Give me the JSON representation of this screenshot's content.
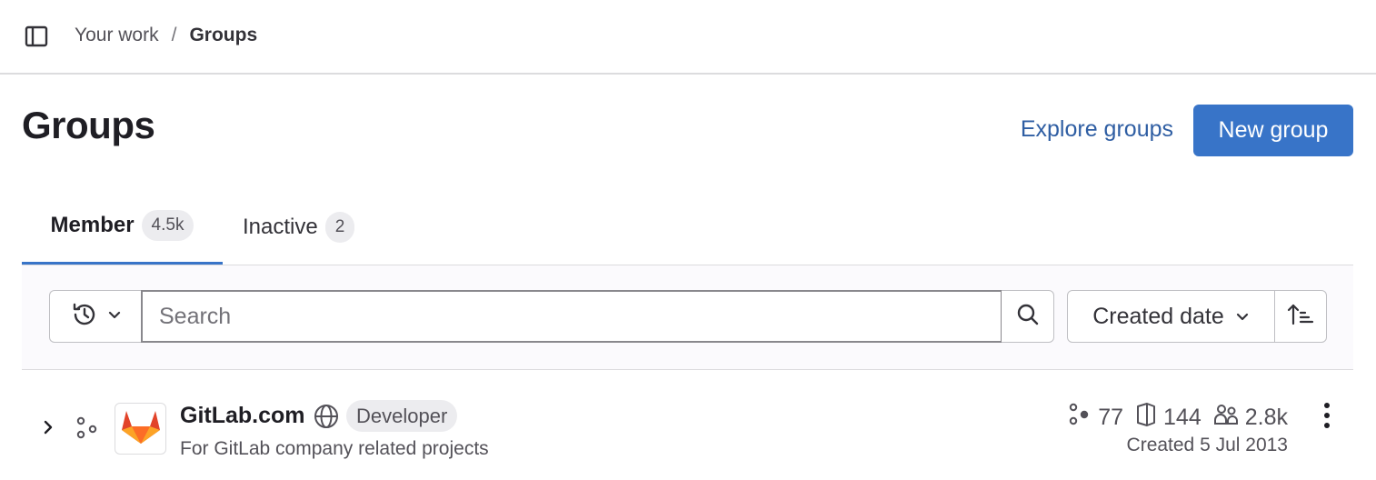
{
  "breadcrumb": {
    "parent": "Your work",
    "separator": "/",
    "current": "Groups"
  },
  "page": {
    "title": "Groups",
    "explore_link": "Explore groups",
    "new_group_button": "New group"
  },
  "tabs": [
    {
      "label": "Member",
      "count": "4.5k",
      "active": true
    },
    {
      "label": "Inactive",
      "count": "2",
      "active": false
    }
  ],
  "filters": {
    "search_placeholder": "Search",
    "sort_label": "Created date"
  },
  "groups": [
    {
      "name": "GitLab.com",
      "visibility_icon": "globe-icon",
      "role": "Developer",
      "description": "For GitLab company related projects",
      "subgroups": "77",
      "projects": "144",
      "members": "2.8k",
      "created": "Created 5 Jul 2013"
    }
  ],
  "colors": {
    "accent": "#3874c8",
    "link": "#2f5ea3",
    "text": "#1f1e24",
    "muted": "#535158"
  }
}
